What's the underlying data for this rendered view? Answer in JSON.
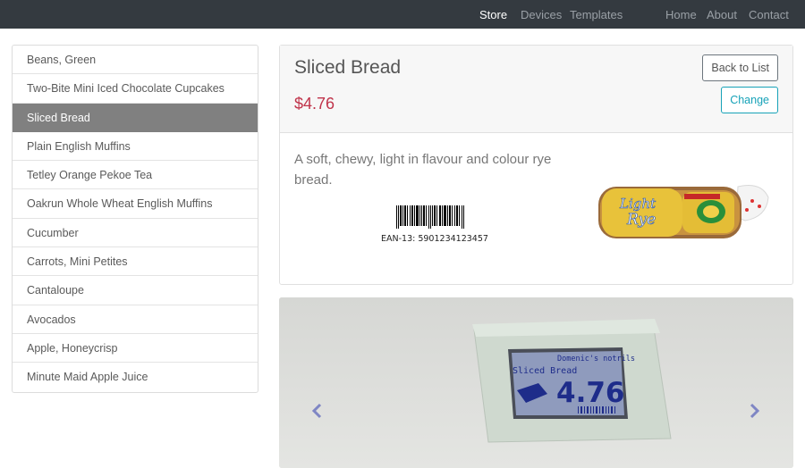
{
  "navbar": {
    "left_links": [
      "Store",
      "Devices",
      "Templates"
    ],
    "active_link": "Store",
    "right_links": [
      "Home",
      "About",
      "Contact"
    ]
  },
  "sidebar": {
    "items": [
      {
        "label": "Beans, Green"
      },
      {
        "label": "Two-Bite Mini Iced Chocolate Cupcakes"
      },
      {
        "label": "Sliced Bread",
        "active": true
      },
      {
        "label": "Plain English Muffins"
      },
      {
        "label": "Tetley Orange Pekoe Tea"
      },
      {
        "label": "Oakrun Whole Wheat English Muffins"
      },
      {
        "label": "Cucumber"
      },
      {
        "label": "Carrots, Mini Petites"
      },
      {
        "label": "Cantaloupe"
      },
      {
        "label": "Avocados"
      },
      {
        "label": "Apple, Honeycrisp"
      },
      {
        "label": "Minute Maid Apple Juice"
      }
    ]
  },
  "product": {
    "title": "Sliced Bread",
    "price": "$4.76",
    "back_label": "Back to List",
    "change_label": "Change",
    "description": "A soft, chewy, light in flavour and colour rye bread.",
    "ean": "EAN-13: 5901234123457",
    "package_text": [
      "Light",
      "Rye"
    ]
  },
  "carousel": {
    "display": {
      "header": "Domenic's notrils",
      "product": "Sliced Bread",
      "price": "4.76"
    },
    "prev_icon": "chevron-left-icon",
    "next_icon": "chevron-right-icon"
  },
  "colors": {
    "navbar_bg": "#343a40",
    "active_item_bg": "#808080",
    "price": "#c0334a",
    "change_button": "#17a2b8"
  }
}
